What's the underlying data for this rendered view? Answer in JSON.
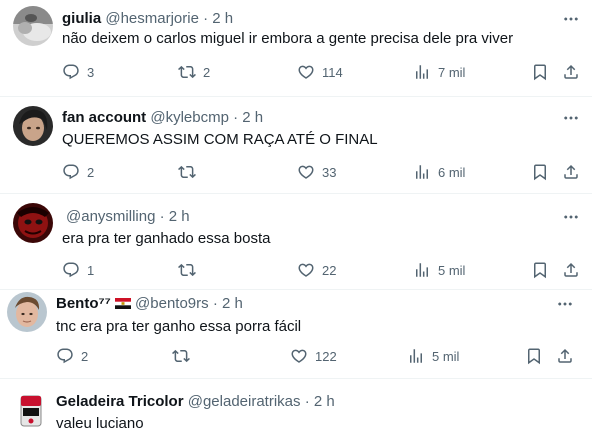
{
  "tweets": [
    {
      "name": "giulia",
      "handle": "@hesmarjorie",
      "sep": "·",
      "time": "2 h",
      "text": "não deixem o carlos miguel ir embora a gente precisa dele pra viver",
      "replies": "3",
      "retweets": "2",
      "likes": "114",
      "views": "7 mil"
    },
    {
      "name": "fan account",
      "handle": "@kylebcmp",
      "sep": "·",
      "time": "2 h",
      "text": "QUEREMOS ASSIM COM RAÇA ATÉ O FINAL",
      "replies": "2",
      "retweets": "",
      "likes": "33",
      "views": "6 mil"
    },
    {
      "name": "",
      "handle": "@anysmilling",
      "sep": "·",
      "time": "2 h",
      "text": "era pra ter ganhado essa bosta",
      "replies": "1",
      "retweets": "",
      "likes": "22",
      "views": "5 mil"
    },
    {
      "name": "Bento⁷⁷",
      "handle": "@bento9rs",
      "sep": "·",
      "time": "2 h",
      "text": "tnc era pra ter ganho essa porra fácil",
      "replies": "2",
      "retweets": "",
      "likes": "122",
      "views": "5 mil"
    },
    {
      "name": "Geladeira Tricolor",
      "handle": "@geladeiratrikas",
      "sep": "·",
      "time": "2 h",
      "text": "valeu luciano"
    }
  ],
  "icons": {
    "reply": "reply-icon",
    "retweet": "retweet-icon",
    "like": "like-icon",
    "views": "views-icon",
    "bookmark": "bookmark-icon",
    "share": "share-icon",
    "more": "more-icon"
  },
  "colors": {
    "text": "#0f1419",
    "secondary": "#536471",
    "divider": "#eff3f4"
  }
}
